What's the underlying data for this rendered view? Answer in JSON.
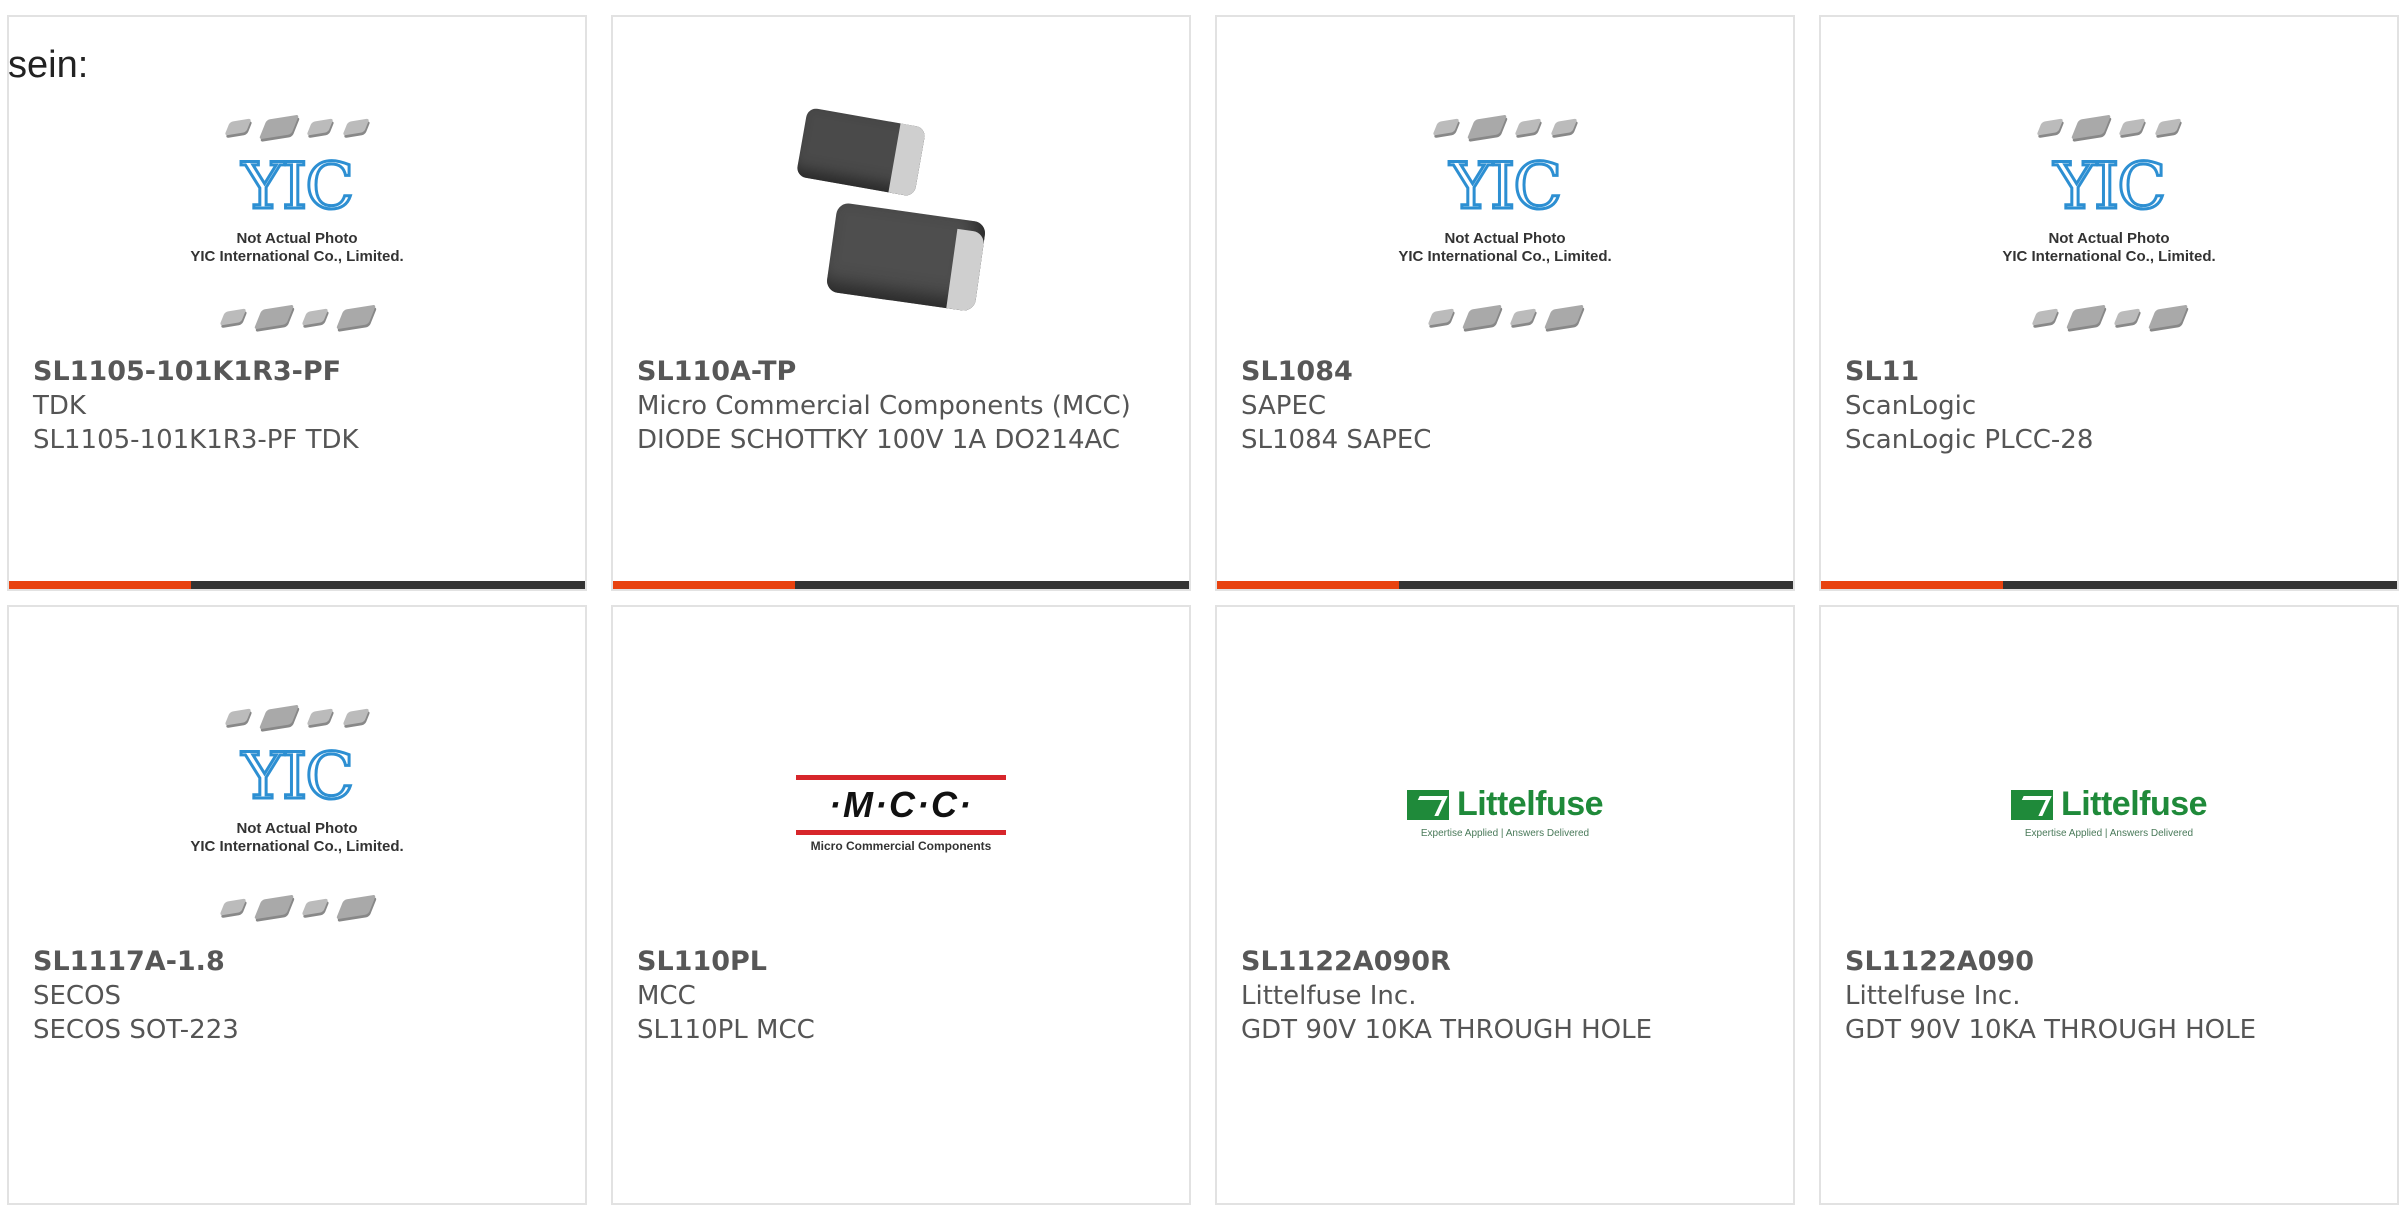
{
  "intro_text": "sein:",
  "placeholder": {
    "logo": "YIC",
    "line1": "Not Actual Photo",
    "line2": "YIC International Co., Limited."
  },
  "brand_logos": {
    "mcc": {
      "word": "·M·C·C·",
      "sub": "Micro Commercial Components"
    },
    "littelfuse": {
      "name": "Littelfuse",
      "tag": "Expertise Applied | Answers Delivered"
    }
  },
  "colors": {
    "accent": "#e8420f",
    "bar": "#333333",
    "border": "#e2e2e2",
    "littelfuse": "#1f8a3a",
    "mcc_red": "#d7262b",
    "yic_blue": "#2d8fd2"
  },
  "products": [
    {
      "part": "SL1105-101K1R3-PF",
      "manufacturer": "TDK",
      "description": "SL1105-101K1R3-PF TDK",
      "image": "yic-placeholder"
    },
    {
      "part": "SL110A-TP",
      "manufacturer": "Micro Commercial Components (MCC)",
      "description": "DIODE SCHOTTKY 100V 1A DO214AC",
      "image": "diode-photo"
    },
    {
      "part": "SL1084",
      "manufacturer": "SAPEC",
      "description": "SL1084 SAPEC",
      "image": "yic-placeholder"
    },
    {
      "part": "SL11",
      "manufacturer": "ScanLogic",
      "description": "ScanLogic PLCC-28",
      "image": "yic-placeholder"
    },
    {
      "part": "SL1117A-1.8",
      "manufacturer": "SECOS",
      "description": "SECOS SOT-223",
      "image": "yic-placeholder"
    },
    {
      "part": "SL110PL",
      "manufacturer": "MCC",
      "description": "SL110PL MCC",
      "image": "mcc-logo"
    },
    {
      "part": "SL1122A090R",
      "manufacturer": "Littelfuse Inc.",
      "description": "GDT 90V 10KA THROUGH HOLE",
      "image": "littelfuse-logo"
    },
    {
      "part": "SL1122A090",
      "manufacturer": "Littelfuse Inc.",
      "description": "GDT 90V 10KA THROUGH HOLE",
      "image": "littelfuse-logo"
    }
  ]
}
